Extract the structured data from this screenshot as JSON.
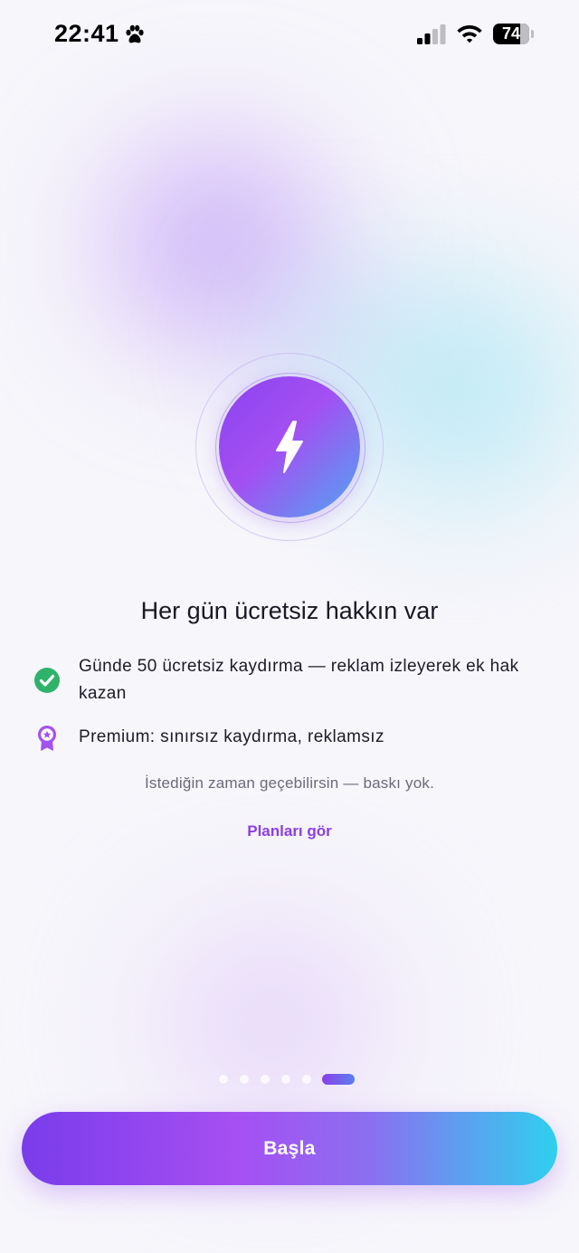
{
  "status_bar": {
    "time": "22:41",
    "battery": "74",
    "battery_level_percent": 74,
    "icons": [
      "paw-icon",
      "signal-icon",
      "wifi-icon",
      "battery-icon"
    ]
  },
  "hero": {
    "icon": "lightning-bolt-icon",
    "gradient_colors": [
      "#8a43f0",
      "#a44ff2",
      "#4fa6f0"
    ]
  },
  "title": "Her gün ücretsiz hakkın var",
  "features": [
    {
      "icon": "check-circle-icon",
      "icon_color": "#2fb36b",
      "text": "Günde 50 ücretsiz kaydırma — reklam izleyerek ek hak kazan"
    },
    {
      "icon": "premium-badge-icon",
      "icon_color": "#a451ee",
      "text": "Premium: sınırsız kaydırma, reklamsız"
    }
  ],
  "subtext": "İstediğin zaman geçebilirsin — baskı yok.",
  "plans_link": "Planları gör",
  "pagination": {
    "total": 6,
    "current": 6
  },
  "cta": {
    "label": "Başla"
  },
  "colors": {
    "accent": "#8b3fe8",
    "cta_start": "#7a3ceb",
    "cta_end": "#2ed0ee",
    "background": "#f7f6fb"
  }
}
